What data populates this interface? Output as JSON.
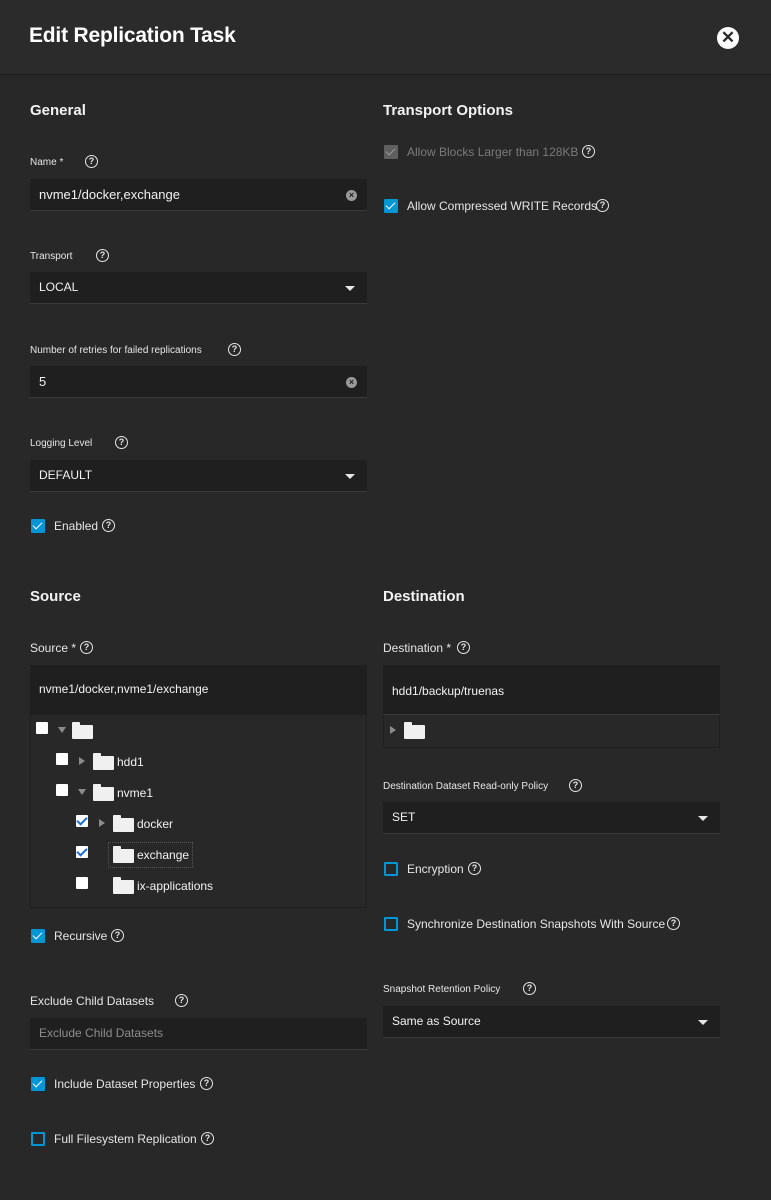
{
  "header": {
    "title": "Edit Replication Task"
  },
  "general": {
    "heading": "General",
    "name": {
      "label": "Name *",
      "value": "nvme1/docker,exchange"
    },
    "transport": {
      "label": "Transport",
      "value": "LOCAL"
    },
    "retries": {
      "label": "Number of retries for failed replications",
      "value": "5"
    },
    "logging": {
      "label": "Logging Level",
      "value": "DEFAULT"
    },
    "enabled": {
      "label": "Enabled",
      "checked": true
    }
  },
  "transport_options": {
    "heading": "Transport Options",
    "large_blocks": {
      "label": "Allow Blocks Larger than 128KB",
      "checked": true,
      "disabled": true
    },
    "compressed": {
      "label": "Allow Compressed WRITE Records",
      "checked": true
    }
  },
  "source": {
    "heading": "Source",
    "label": "Source *",
    "value": "nvme1/docker,nvme1/exchange",
    "tree": {
      "hdd1": "hdd1",
      "nvme1": "nvme1",
      "docker": "docker",
      "exchange": "exchange",
      "ix_applications": "ix-applications"
    },
    "recursive": {
      "label": "Recursive",
      "checked": true
    },
    "exclude": {
      "label": "Exclude Child Datasets",
      "placeholder": "Exclude Child Datasets"
    },
    "include_props": {
      "label": "Include Dataset Properties",
      "checked": true
    },
    "full_fs": {
      "label": "Full Filesystem Replication",
      "checked": false
    }
  },
  "destination": {
    "heading": "Destination",
    "label": "Destination *",
    "value": "hdd1/backup/truenas",
    "readonly_policy": {
      "label": "Destination Dataset Read-only Policy",
      "value": "SET"
    },
    "encryption": {
      "label": "Encryption",
      "checked": false
    },
    "sync_snapshots": {
      "label": "Synchronize Destination Snapshots With Source",
      "checked": false
    },
    "retention": {
      "label": "Snapshot Retention Policy",
      "value": "Same as Source"
    }
  },
  "colors": {
    "background": "#282828",
    "field": "#1f1f1f",
    "accent": "#0095d5"
  },
  "icons": [
    "close-icon",
    "help-icon",
    "clear-icon",
    "chevron-down-icon",
    "folder-icon",
    "expand-arrow-icon"
  ]
}
